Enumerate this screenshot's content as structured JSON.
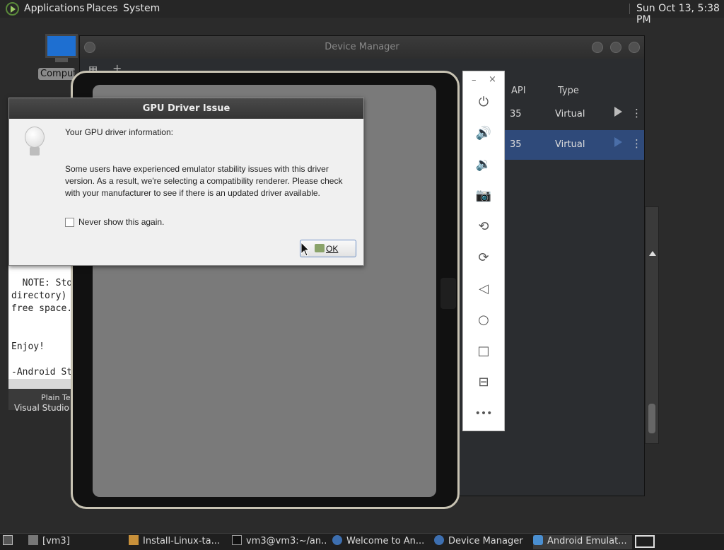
{
  "top_panel": {
    "menus": [
      "Applications",
      "Places",
      "System"
    ],
    "clock": "Sun Oct 13,  5:38 PM"
  },
  "desktop": {
    "computer_label": "Computer"
  },
  "editor": {
    "text": "  NOTE: Sto\ndirectory)\nfree space.\n\n\nEnjoy!\n\n-Android St",
    "mode_label": "Plain Te",
    "vscode_label": "Visual Studio C"
  },
  "device_manager": {
    "title": "Device Manager",
    "columns": {
      "api": "API",
      "type": "Type"
    },
    "rows": [
      {
        "api": "35",
        "type": "Virtual"
      },
      {
        "api": "35",
        "type": "Virtual"
      }
    ]
  },
  "emulator_toolbar": {
    "minimize": "–",
    "close": "×",
    "buttons": [
      {
        "name": "power",
        "glyph": "⏻"
      },
      {
        "name": "volume-up",
        "glyph": "🔊"
      },
      {
        "name": "volume-down",
        "glyph": "🔉"
      },
      {
        "name": "camera",
        "glyph": "📷"
      },
      {
        "name": "rotate-left",
        "glyph": "⟲"
      },
      {
        "name": "rotate-right",
        "glyph": "⟳"
      },
      {
        "name": "back",
        "glyph": "◁"
      },
      {
        "name": "home",
        "glyph": "○"
      },
      {
        "name": "overview",
        "glyph": "□"
      },
      {
        "name": "fold",
        "glyph": "⊟"
      },
      {
        "name": "more",
        "glyph": "•••"
      }
    ]
  },
  "gpu_dialog": {
    "title": "GPU Driver Issue",
    "heading": "Your GPU driver information:",
    "body": "Some users have experienced emulator stability issues with this driver version.  As a result, we're selecting a compatibility renderer.  Please check with your manufacturer to see if there is an updated driver available.",
    "checkbox_label": "Never show this again.",
    "ok_label": "OK"
  },
  "taskbar": {
    "items": [
      "[vm3]",
      "Install-Linux-ta...",
      "vm3@vm3:~/an...",
      "Welcome to An...",
      "Device Manager",
      "Android Emulat..."
    ]
  }
}
